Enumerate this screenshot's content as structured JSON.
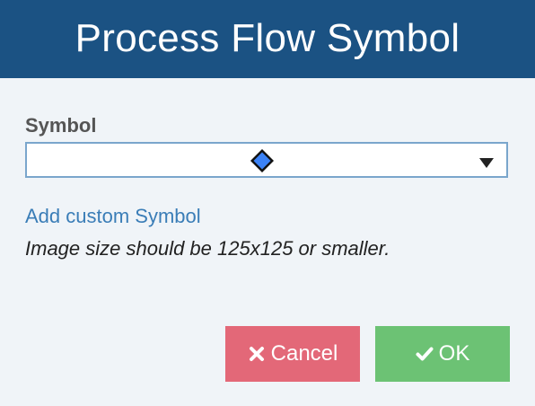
{
  "dialog": {
    "title": "Process Flow Symbol"
  },
  "symbol_field": {
    "label": "Symbol",
    "selected_icon": "blue-diamond-icon",
    "accent_color": "#3b82f6"
  },
  "add_custom_link": "Add custom Symbol",
  "hint": "Image size should be 125x125 or smaller.",
  "buttons": {
    "cancel_label": "Cancel",
    "cancel_icon": "close-icon",
    "cancel_color": "#e36878",
    "ok_label": "OK",
    "ok_icon": "check-icon",
    "ok_color": "#6cc274"
  },
  "colors": {
    "header": "#1b5283",
    "link": "#3a7db7"
  }
}
